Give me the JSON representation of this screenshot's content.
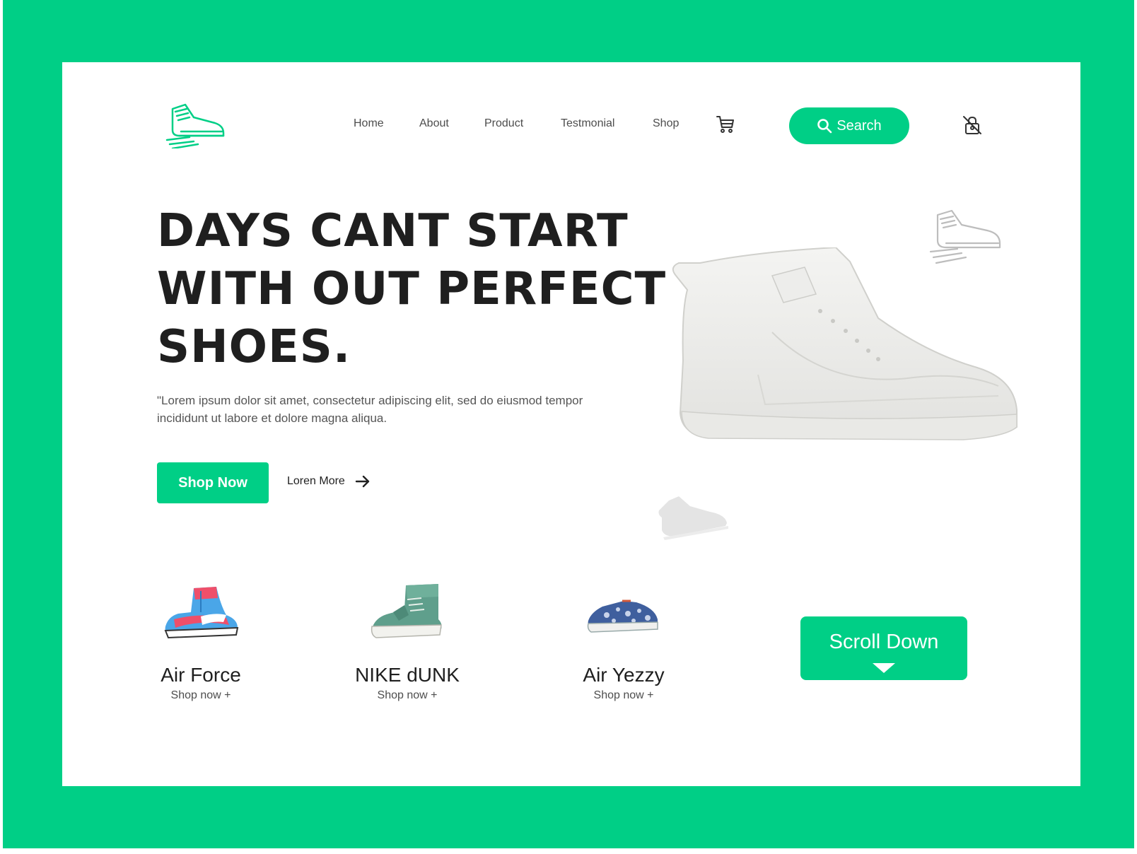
{
  "colors": {
    "accent": "#00CF86",
    "text_dark": "#1f1f1f",
    "text_muted": "#555555"
  },
  "header": {
    "logo_icon": "sneaker-logo-icon",
    "nav": [
      "Home",
      "About",
      "Product",
      "Testmonial",
      "Shop"
    ],
    "cart_icon": "shopping-cart-icon",
    "search_label": "Search",
    "search_icon": "search-icon",
    "account_icon": "lock-user-icon"
  },
  "hero": {
    "title_lines": [
      "DAYS CANT START",
      "WITH OUT PERFECT",
      "SHOES."
    ],
    "description": "\"Lorem ipsum dolor sit amet, consectetur adipiscing elit, sed do eiusmod tempor incididunt ut labore et dolore magna aliqua.",
    "shop_now_label": "Shop Now",
    "loren_more_label": "Loren More",
    "arrow_icon": "arrow-right-icon"
  },
  "products": [
    {
      "name": "Air Force",
      "link": "Shop now +"
    },
    {
      "name": "NIKE dUNK",
      "link": "Shop now +"
    },
    {
      "name": "Air Yezzy",
      "link": "Shop now +"
    }
  ],
  "scroll_down_label": "Scroll Down"
}
